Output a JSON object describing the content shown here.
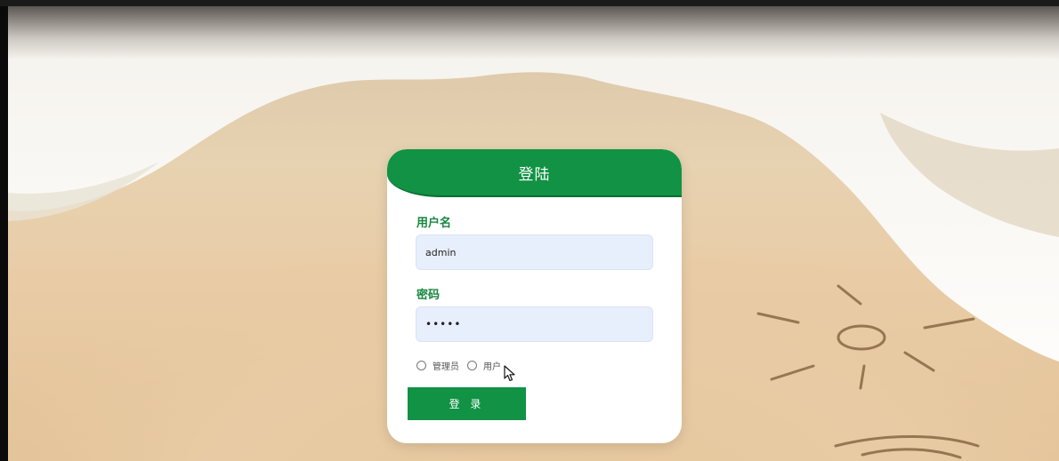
{
  "login_card": {
    "title": "登陆",
    "username_label": "用户名",
    "username_value": "admin",
    "password_label": "密码",
    "password_value": "•••••",
    "roles": [
      {
        "label": "管理员"
      },
      {
        "label": "用户"
      }
    ],
    "submit_label": "登 录"
  },
  "colors": {
    "primary_green": "#119244",
    "label_green": "#17863f",
    "input_bg": "#e8effc"
  }
}
